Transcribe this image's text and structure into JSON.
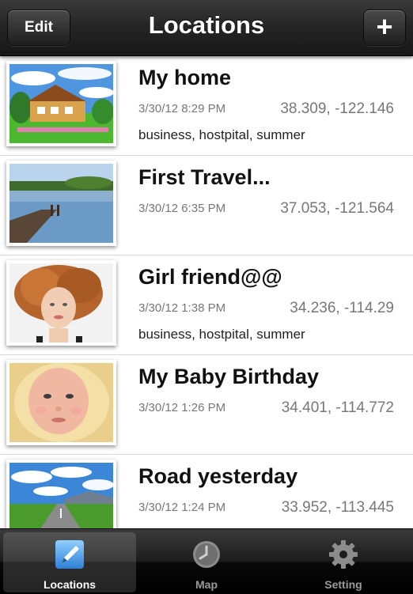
{
  "navbar": {
    "title": "Locations",
    "edit_label": "Edit",
    "add_icon": "plus-icon"
  },
  "locations": [
    {
      "title": "My home",
      "date": "3/30/12 8:29 PM",
      "coords": "38.309, -122.146",
      "tags": "business, hostpital, summer",
      "thumbnail": "house-photo"
    },
    {
      "title": "First Travel...",
      "date": "3/30/12 6:35 PM",
      "coords": "37.053, -121.564",
      "tags": "",
      "thumbnail": "lake-dock-photo"
    },
    {
      "title": "Girl friend@@",
      "date": "3/30/12 1:38 PM",
      "coords": "34.236, -114.29",
      "tags": "business, hostpital, summer",
      "thumbnail": "woman-portrait-photo"
    },
    {
      "title": "My Baby Birthday",
      "date": "3/30/12 1:26 PM",
      "coords": "34.401, -114.772",
      "tags": "",
      "thumbnail": "baby-photo"
    },
    {
      "title": "Road yesterday",
      "date": "3/30/12 1:24 PM",
      "coords": "33.952, -113.445",
      "tags": "",
      "thumbnail": "road-landscape-photo"
    }
  ],
  "tabbar": {
    "tabs": [
      {
        "label": "Locations",
        "icon": "pencil-icon",
        "active": true
      },
      {
        "label": "Map",
        "icon": "clock-icon",
        "active": false
      },
      {
        "label": "Setting",
        "icon": "gear-icon",
        "active": false
      }
    ]
  },
  "colors": {
    "navbar_bg": "#262626",
    "active_icon": "#5aa6e8",
    "inactive_icon": "#8c8c8c"
  }
}
